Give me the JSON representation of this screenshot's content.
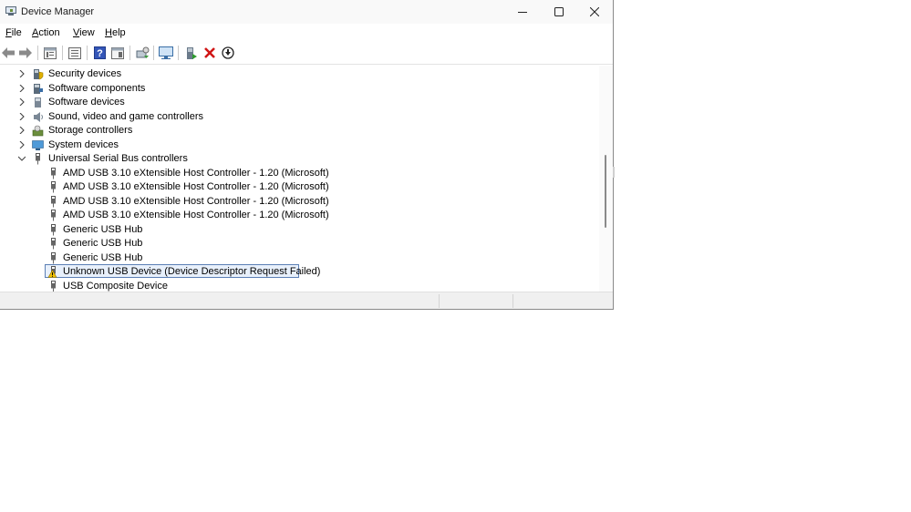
{
  "window": {
    "title": "Device Manager"
  },
  "menu": [
    {
      "label_first": "F",
      "label_rest": "ile"
    },
    {
      "label_first": "A",
      "label_rest": "ction"
    },
    {
      "label_first": "V",
      "label_rest": "iew"
    },
    {
      "label_first": "H",
      "label_rest": "elp"
    }
  ],
  "toolbar_icons": [
    "back-arrow-icon",
    "forward-arrow-icon",
    "properties-window-icon",
    "list-view-icon",
    "help-icon",
    "details-window-icon",
    "scan-hardware-icon",
    "monitor-icon",
    "update-driver-icon",
    "uninstall-x-icon",
    "download-circle-icon"
  ],
  "tree": {
    "categories_collapsed": [
      {
        "label": "Security devices",
        "icon": "security-devices-icon"
      },
      {
        "label": "Software components",
        "icon": "software-components-icon"
      },
      {
        "label": "Software devices",
        "icon": "software-devices-icon"
      },
      {
        "label": "Sound, video and game controllers",
        "icon": "sound-icon"
      },
      {
        "label": "Storage controllers",
        "icon": "storage-controllers-icon"
      },
      {
        "label": "System devices",
        "icon": "system-devices-icon"
      }
    ],
    "expanded_category": {
      "label": "Universal Serial Bus controllers",
      "icon": "usb-plug-icon",
      "children": [
        {
          "label": "AMD USB 3.10 eXtensible Host Controller - 1.20 (Microsoft)",
          "icon": "usb-plug-icon"
        },
        {
          "label": "AMD USB 3.10 eXtensible Host Controller - 1.20 (Microsoft)",
          "icon": "usb-plug-icon"
        },
        {
          "label": "AMD USB 3.10 eXtensible Host Controller - 1.20 (Microsoft)",
          "icon": "usb-plug-icon"
        },
        {
          "label": "AMD USB 3.10 eXtensible Host Controller - 1.20 (Microsoft)",
          "icon": "usb-plug-icon"
        },
        {
          "label": "Generic USB Hub",
          "icon": "usb-plug-icon"
        },
        {
          "label": "Generic USB Hub",
          "icon": "usb-plug-icon"
        },
        {
          "label": "Generic USB Hub",
          "icon": "usb-plug-icon"
        },
        {
          "label": "Unknown USB Device (Device Descriptor Request Failed)",
          "icon": "warning-usb-icon",
          "selected": true
        },
        {
          "label": "USB Composite Device",
          "icon": "usb-plug-icon"
        }
      ]
    }
  },
  "colors": {
    "warning": "#f2c200",
    "uninstall_red": "#d01515",
    "selection_border": "#5b7fb5"
  }
}
